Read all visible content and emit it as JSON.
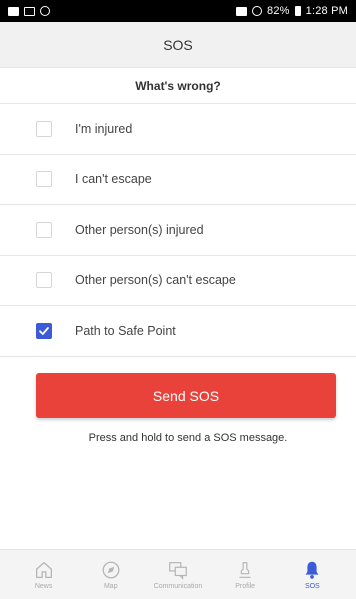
{
  "status_bar": {
    "time": "1:28 PM",
    "battery": "82%"
  },
  "header": {
    "title": "SOS"
  },
  "subheader": {
    "title": "What's wrong?"
  },
  "options": [
    {
      "label": "I'm injured",
      "checked": false
    },
    {
      "label": "I can't escape",
      "checked": false
    },
    {
      "label": "Other person(s) injured",
      "checked": false
    },
    {
      "label": "Other person(s) can't escape",
      "checked": false
    },
    {
      "label": "Path to Safe Point",
      "checked": true
    }
  ],
  "send_button": {
    "label": "Send SOS",
    "color": "#e8423a"
  },
  "hint": {
    "text": "Press and hold to send a SOS message."
  },
  "tabs": [
    {
      "label": "News",
      "icon": "home-icon",
      "active": false
    },
    {
      "label": "Map",
      "icon": "compass-icon",
      "active": false
    },
    {
      "label": "Communication",
      "icon": "chat-icon",
      "active": false
    },
    {
      "label": "Profile",
      "icon": "person-icon",
      "active": false
    },
    {
      "label": "SOS",
      "icon": "bell-icon",
      "active": true
    }
  ],
  "colors": {
    "accent": "#3b5bd8",
    "danger": "#e8423a"
  }
}
